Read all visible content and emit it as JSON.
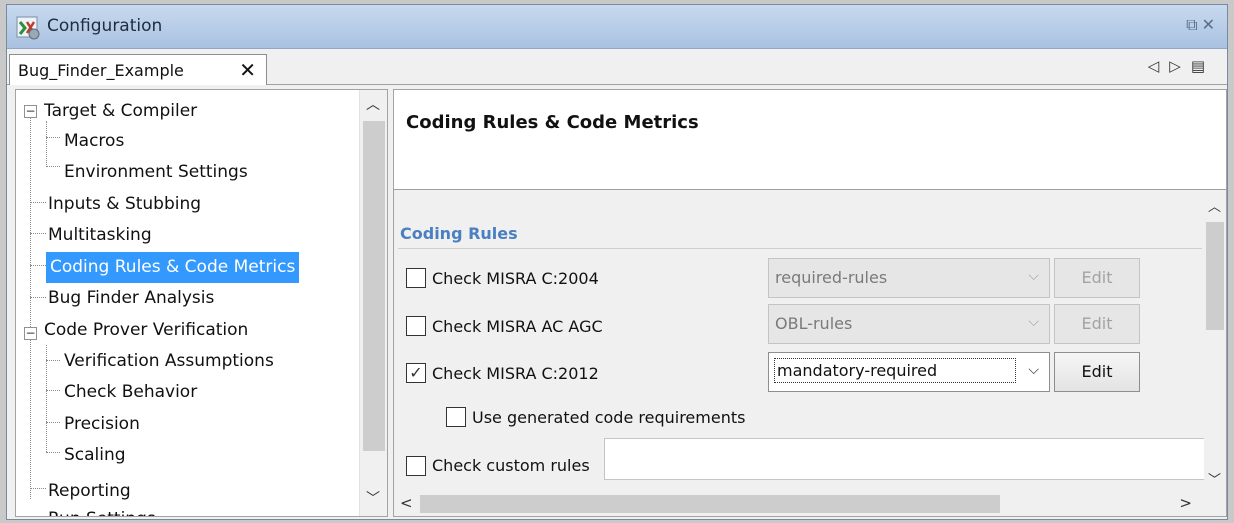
{
  "window": {
    "title": "Configuration",
    "controls": "⧉✕"
  },
  "tabs": [
    {
      "label": "Bug_Finder_Example",
      "close": "✕"
    }
  ],
  "tab_nav": {
    "prev": "◁",
    "next": "▷",
    "menu": "▤"
  },
  "tree": {
    "items": [
      {
        "label": "Target & Compiler",
        "expander": "−"
      },
      {
        "label": "Macros"
      },
      {
        "label": "Environment Settings"
      },
      {
        "label": "Inputs & Stubbing"
      },
      {
        "label": "Multitasking"
      },
      {
        "label": "Coding Rules & Code Metrics",
        "selected": true
      },
      {
        "label": "Bug Finder Analysis"
      },
      {
        "label": "Code Prover Verification",
        "expander": "−"
      },
      {
        "label": "Verification Assumptions"
      },
      {
        "label": "Check Behavior"
      },
      {
        "label": "Precision"
      },
      {
        "label": "Scaling"
      },
      {
        "label": "Reporting"
      },
      {
        "label": "Run Settings"
      }
    ]
  },
  "content": {
    "title": "Coding Rules & Code Metrics",
    "section": "Coding Rules",
    "rules": [
      {
        "label": "Check MISRA C:2004",
        "checked": false,
        "dropdown": "required-rules",
        "edit": "Edit",
        "enabled": false
      },
      {
        "label": "Check MISRA AC AGC",
        "checked": false,
        "dropdown": "OBL-rules",
        "edit": "Edit",
        "enabled": false
      },
      {
        "label": "Check MISRA C:2012",
        "checked": true,
        "dropdown": "mandatory-required",
        "edit": "Edit",
        "enabled": true
      }
    ],
    "generated_code": {
      "label": "Use generated code requirements",
      "checked": false
    },
    "custom_rules": {
      "label": "Check custom rules",
      "checked": false,
      "value": ""
    }
  },
  "glyphs": {
    "check": "✓",
    "chevron_down": "⌵",
    "up": "︿",
    "down": "﹀",
    "left": "<",
    "right": ">"
  }
}
